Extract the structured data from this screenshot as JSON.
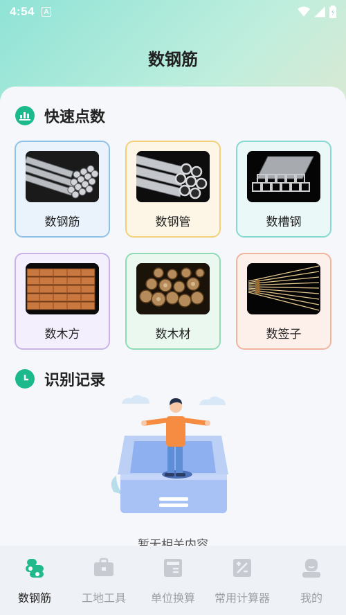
{
  "status_bar": {
    "time": "4:54",
    "notif_letter": "A"
  },
  "app_title": "数钢筋",
  "quick_count": {
    "title": "快速点数",
    "tiles": [
      {
        "label": "数钢筋",
        "border": "#8fc2e8",
        "bg": "#eaf3fc"
      },
      {
        "label": "数钢管",
        "border": "#f3cf7a",
        "bg": "#fdf6e6"
      },
      {
        "label": "数槽钢",
        "border": "#86d8d2",
        "bg": "#eaf8f7"
      },
      {
        "label": "数木方",
        "border": "#c7b3ea",
        "bg": "#f4effc"
      },
      {
        "label": "数木材",
        "border": "#8fdbb6",
        "bg": "#eaf8f0"
      },
      {
        "label": "数签子",
        "border": "#f1b59e",
        "bg": "#fdf0eb"
      }
    ]
  },
  "records": {
    "title": "识别记录",
    "empty_text": "暂无相关内容"
  },
  "nav": [
    {
      "label": "数钢筋",
      "icon": "rebar-icon",
      "active": true
    },
    {
      "label": "工地工具",
      "icon": "toolbox-icon",
      "active": false
    },
    {
      "label": "单位换算",
      "icon": "convert-icon",
      "active": false
    },
    {
      "label": "常用计算器",
      "icon": "calculator-icon",
      "active": false
    },
    {
      "label": "我的",
      "icon": "profile-icon",
      "active": false
    }
  ],
  "colors": {
    "accent": "#1bb98c",
    "inactive": "#9aa0a6"
  }
}
